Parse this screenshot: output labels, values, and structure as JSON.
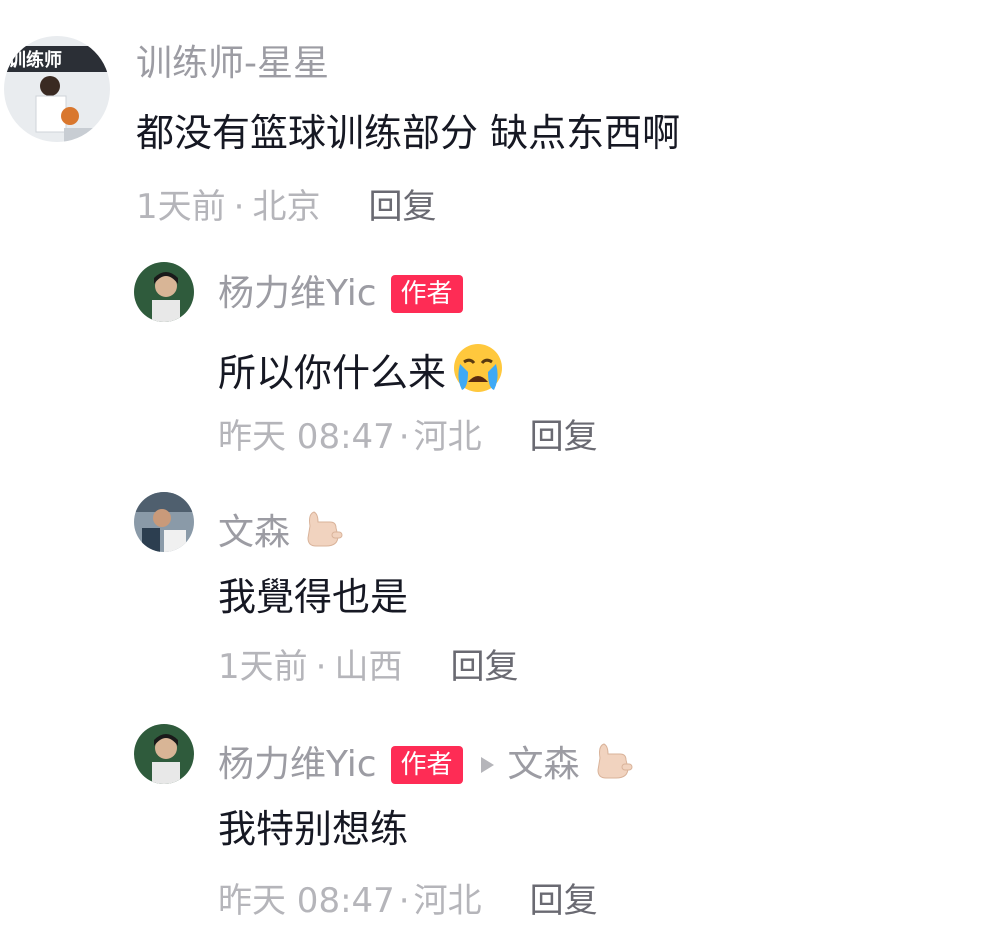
{
  "comments": [
    {
      "user": "训练师-星星",
      "text": "都没有篮球训练部分 缺点东西啊",
      "time": "1天前",
      "location": "北京",
      "reply": "回复"
    },
    {
      "user": "杨力维Yic",
      "badge": "作者",
      "text": "所以你什么来",
      "text_emoji": "loudly-crying-face-icon",
      "time": "昨天 08:47",
      "location": "河北",
      "reply": "回复"
    },
    {
      "user": "文森",
      "user_emoji": "call-me-hand-icon",
      "text": "我覺得也是",
      "time": "1天前",
      "location": "山西",
      "reply": "回复"
    },
    {
      "user": "杨力维Yic",
      "badge": "作者",
      "reply_to": "文森",
      "reply_to_emoji": "call-me-hand-icon",
      "text": "我特别想练",
      "time": "昨天 08:47",
      "location": "河北",
      "reply": "回复"
    }
  ],
  "separator": "·",
  "colors": {
    "badge": "#fe2c55",
    "username": "#9c9ca3",
    "body": "#161823",
    "meta": "#b5b5ba",
    "reply": "#6a6a72"
  }
}
